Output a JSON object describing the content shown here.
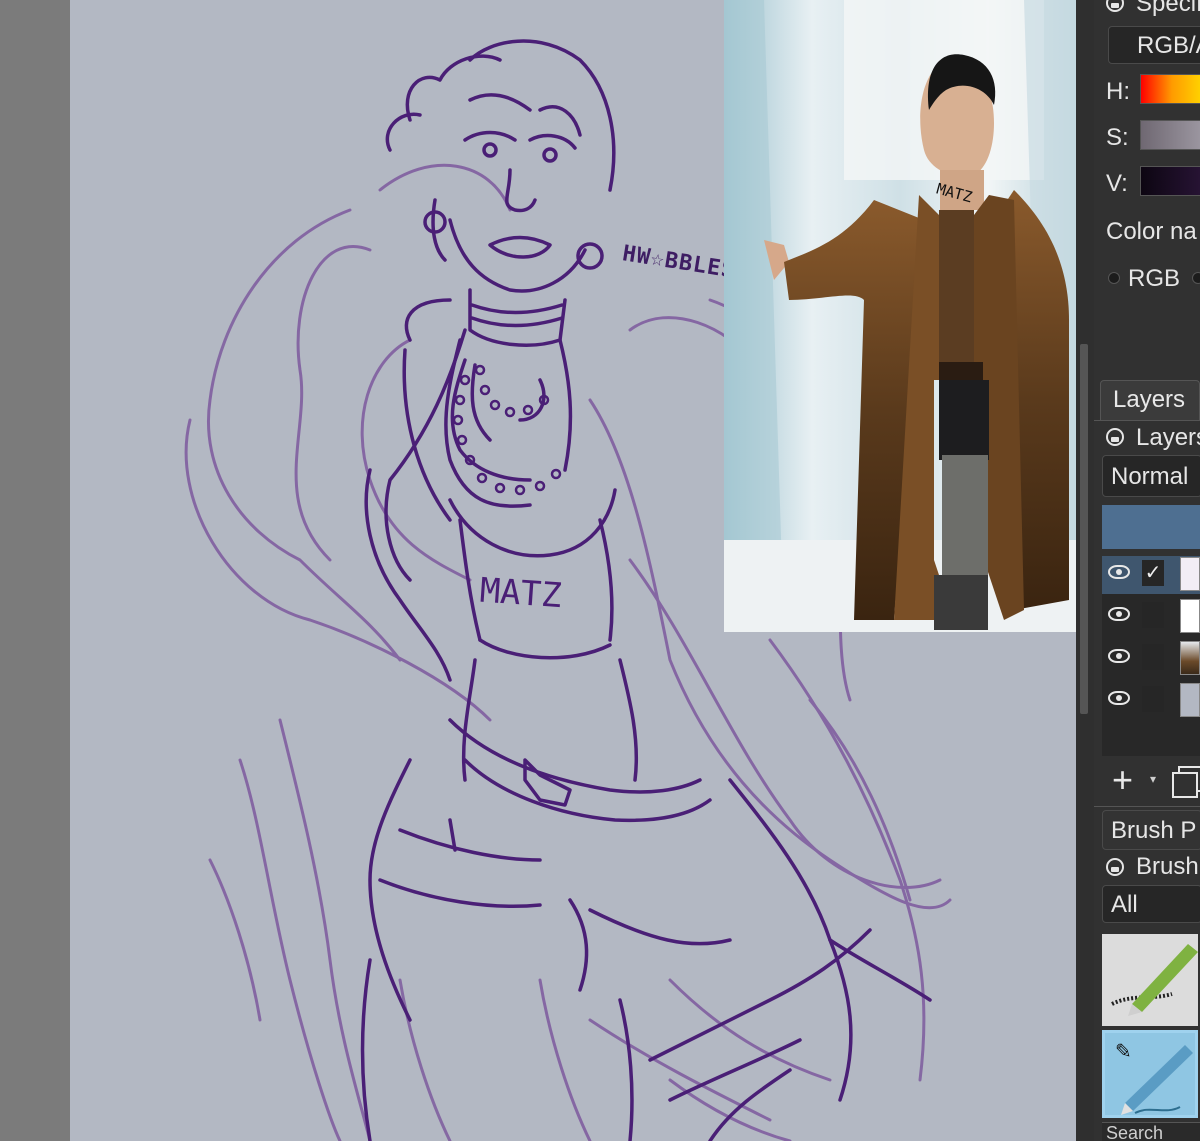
{
  "canvas": {
    "background_color": "#b3b8c3",
    "stroke_colors": {
      "lineart": "#4a1f76",
      "sketch": "#7d5a9e"
    },
    "watermark_text": "HW☆BBLES",
    "shirt_text": "MATZ"
  },
  "reference_photo": {
    "neck_text": "MATZ"
  },
  "color_panel": {
    "title": "Specific",
    "model_value": "RGB/A",
    "h_label": "H:",
    "s_label": "S:",
    "v_label": "V:",
    "color_name_label": "Color na",
    "rgb_radio_label": "RGB"
  },
  "layers_panel": {
    "tab_label": "Layers",
    "header_label": "Layers",
    "blend_mode": "Normal",
    "selected_check": "✓",
    "layers": [
      {
        "visible": true,
        "checked": true,
        "thumb": "sketch"
      },
      {
        "visible": true,
        "checked": false,
        "thumb": "white"
      },
      {
        "visible": true,
        "checked": false,
        "thumb": "photo"
      },
      {
        "visible": true,
        "checked": false,
        "thumb": "background"
      }
    ]
  },
  "brush_panel": {
    "title": "Brush P",
    "header_label": "Brush",
    "filter_value": "All",
    "search_label": "Search"
  }
}
